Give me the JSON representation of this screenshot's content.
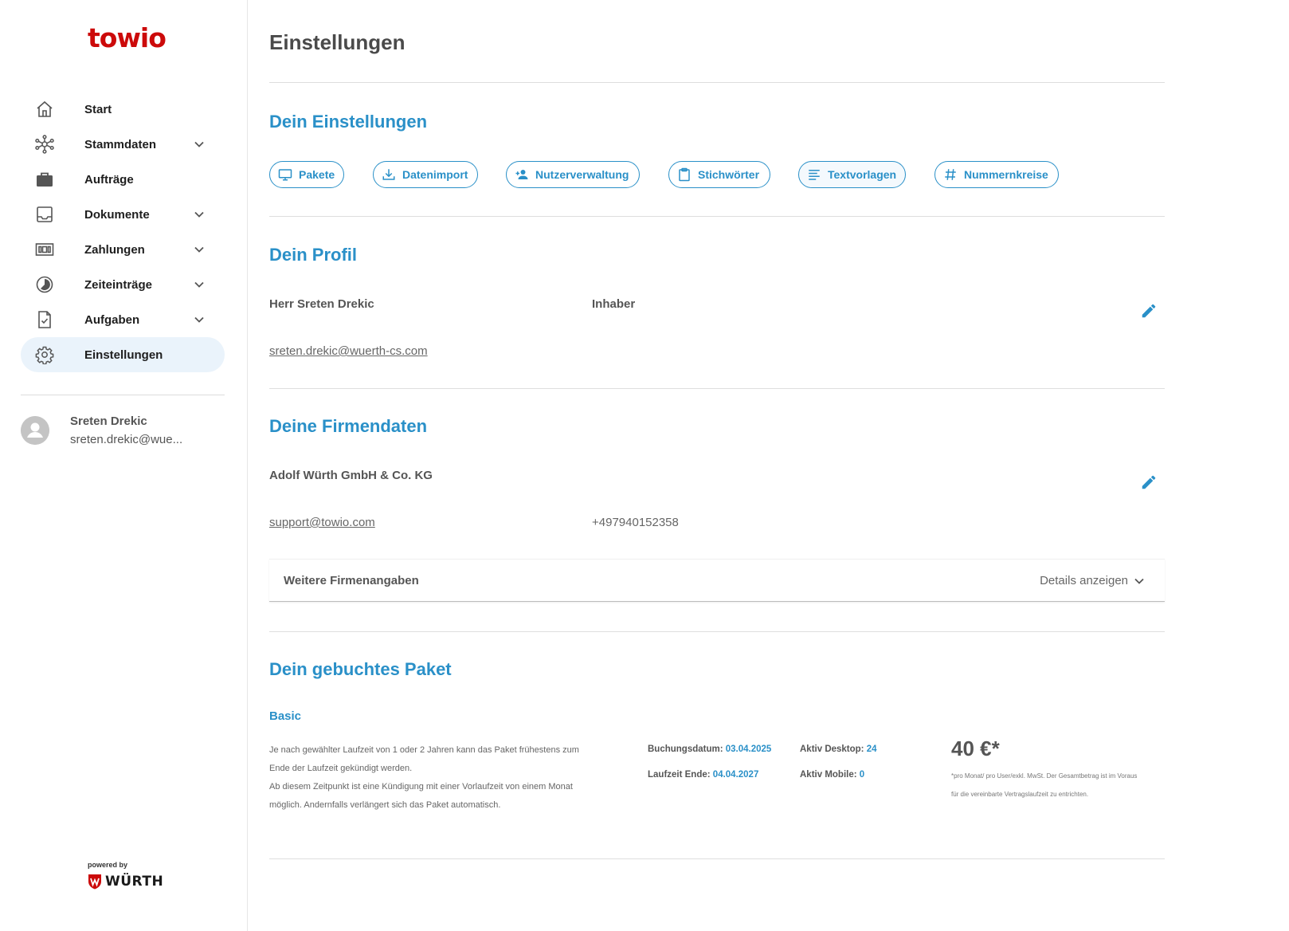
{
  "brand": {
    "logo_text": "towio",
    "powered_by": "powered by",
    "partner": "WÜRTH",
    "logo_color": "#cc0a0a",
    "accent": "#2a90c8"
  },
  "sidebar": {
    "items": [
      {
        "label": "Start",
        "icon": "home-icon",
        "expandable": false,
        "active": false
      },
      {
        "label": "Stammdaten",
        "icon": "network-icon",
        "expandable": true,
        "active": false
      },
      {
        "label": "Aufträge",
        "icon": "briefcase-icon",
        "expandable": false,
        "active": false
      },
      {
        "label": "Dokumente",
        "icon": "inbox-icon",
        "expandable": true,
        "active": false
      },
      {
        "label": "Zahlungen",
        "icon": "money-icon",
        "expandable": true,
        "active": false
      },
      {
        "label": "Zeiteinträge",
        "icon": "clock-icon",
        "expandable": true,
        "active": false
      },
      {
        "label": "Aufgaben",
        "icon": "task-icon",
        "expandable": true,
        "active": false
      },
      {
        "label": "Einstellungen",
        "icon": "gear-icon",
        "expandable": false,
        "active": true
      }
    ],
    "user": {
      "name": "Sreten Drekic",
      "email": "sreten.drekic@wue..."
    }
  },
  "page": {
    "title": "Einstellungen"
  },
  "settings": {
    "title": "Dein Einstellungen",
    "pills": [
      {
        "label": "Pakete",
        "icon": "monitor-icon",
        "active": false
      },
      {
        "label": "Datenimport",
        "icon": "download-icon",
        "active": false
      },
      {
        "label": "Nutzerverwaltung",
        "icon": "add-user-icon",
        "active": false
      },
      {
        "label": "Stichwörter",
        "icon": "clipboard-icon",
        "active": false
      },
      {
        "label": "Textvorlagen",
        "icon": "text-lines-icon",
        "active": true
      },
      {
        "label": "Nummernkreise",
        "icon": "hash-icon",
        "active": false
      }
    ]
  },
  "profile": {
    "title": "Dein Profil",
    "name": "Herr Sreten Drekic",
    "role": "Inhaber",
    "email": "sreten.drekic@wuerth-cs.com"
  },
  "company": {
    "title": "Deine Firmendaten",
    "name": "Adolf Würth GmbH & Co. KG",
    "email": "support@towio.com",
    "phone": "+497940152358",
    "more_label": "Weitere Firmenangaben",
    "more_action": "Details anzeigen"
  },
  "package": {
    "title": "Dein gebuchtes Paket",
    "name": "Basic",
    "note_line1": "Je nach gewählter Laufzeit von 1 oder 2 Jahren kann das Paket frühestens zum",
    "note_line2": "Ende der Laufzeit gekündigt werden.",
    "note_line3": "Ab diesem Zeitpunkt ist eine Kündigung mit einer Vorlaufzeit von einem Monat",
    "note_line4": "möglich. Andernfalls verlängert sich das Paket automatisch.",
    "booking_label": "Buchungsdatum:",
    "booking_value": "03.04.2025",
    "end_label": "Laufzeit Ende:",
    "end_value": "04.04.2027",
    "desktop_label": "Aktiv Desktop:",
    "desktop_value": "24",
    "mobile_label": "Aktiv Mobile:",
    "mobile_value": "0",
    "price": "40 €*",
    "price_note_line1": "*pro Monat/ pro User/exkl. MwSt. Der Gesamtbetrag ist im Voraus",
    "price_note_line2": "für die vereinbarte Vertragslaufzeit zu entrichten."
  }
}
